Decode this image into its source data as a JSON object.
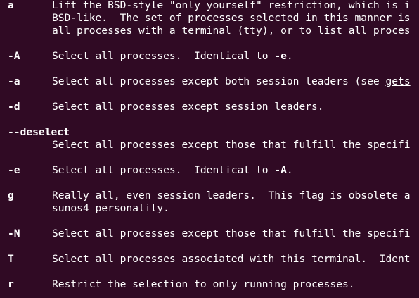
{
  "terminal": {
    "lines": [
      {
        "flag": "a",
        "text": "Lift the BSD-style \"only yourself\" restriction, which is i"
      },
      {
        "text": "BSD-like.  The set of processes selected in this manner is"
      },
      {
        "text": "all processes with a terminal (tty), or to list all proces"
      },
      {
        "flag": "-A",
        "text_before": "Select all processes.  Identical to ",
        "ref": "-e",
        "text_after": "."
      },
      {
        "flag": "-a",
        "text_before": "Select all processes except both session leaders (see ",
        "link": "gets"
      },
      {
        "flag": "-d",
        "text": "Select all processes except session leaders."
      },
      {
        "flag": "--deselect"
      },
      {
        "text": "Select all processes except those that fulfill the specifi"
      },
      {
        "flag": "-e",
        "text_before": "Select all processes.  Identical to ",
        "ref": "-A",
        "text_after": "."
      },
      {
        "flag": "g",
        "text": "Really all, even session leaders.  This flag is obsolete a"
      },
      {
        "text": "sunos4 personality."
      },
      {
        "flag": "-N",
        "text": "Select all processes except those that fulfill the specifi"
      },
      {
        "flag": "T",
        "text": "Select all processes associated with this terminal.  Ident"
      },
      {
        "flag": "r",
        "text": "Restrict the selection to only running processes."
      }
    ]
  }
}
